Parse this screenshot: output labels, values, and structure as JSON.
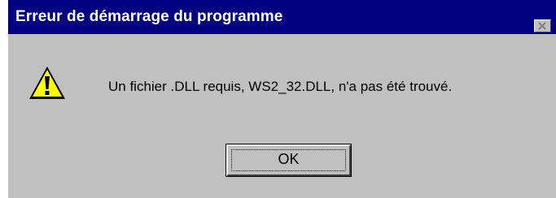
{
  "dialog": {
    "title": "Erreur de démarrage du programme",
    "message": "Un fichier .DLL requis, WS2_32.DLL, n'a pas été trouvé.",
    "icon": "warning-icon",
    "ok_label": "OK",
    "close_icon": "close-icon"
  },
  "colors": {
    "titlebar": "#000080",
    "face": "#c0c0c0",
    "warning_yellow": "#ffff00"
  }
}
